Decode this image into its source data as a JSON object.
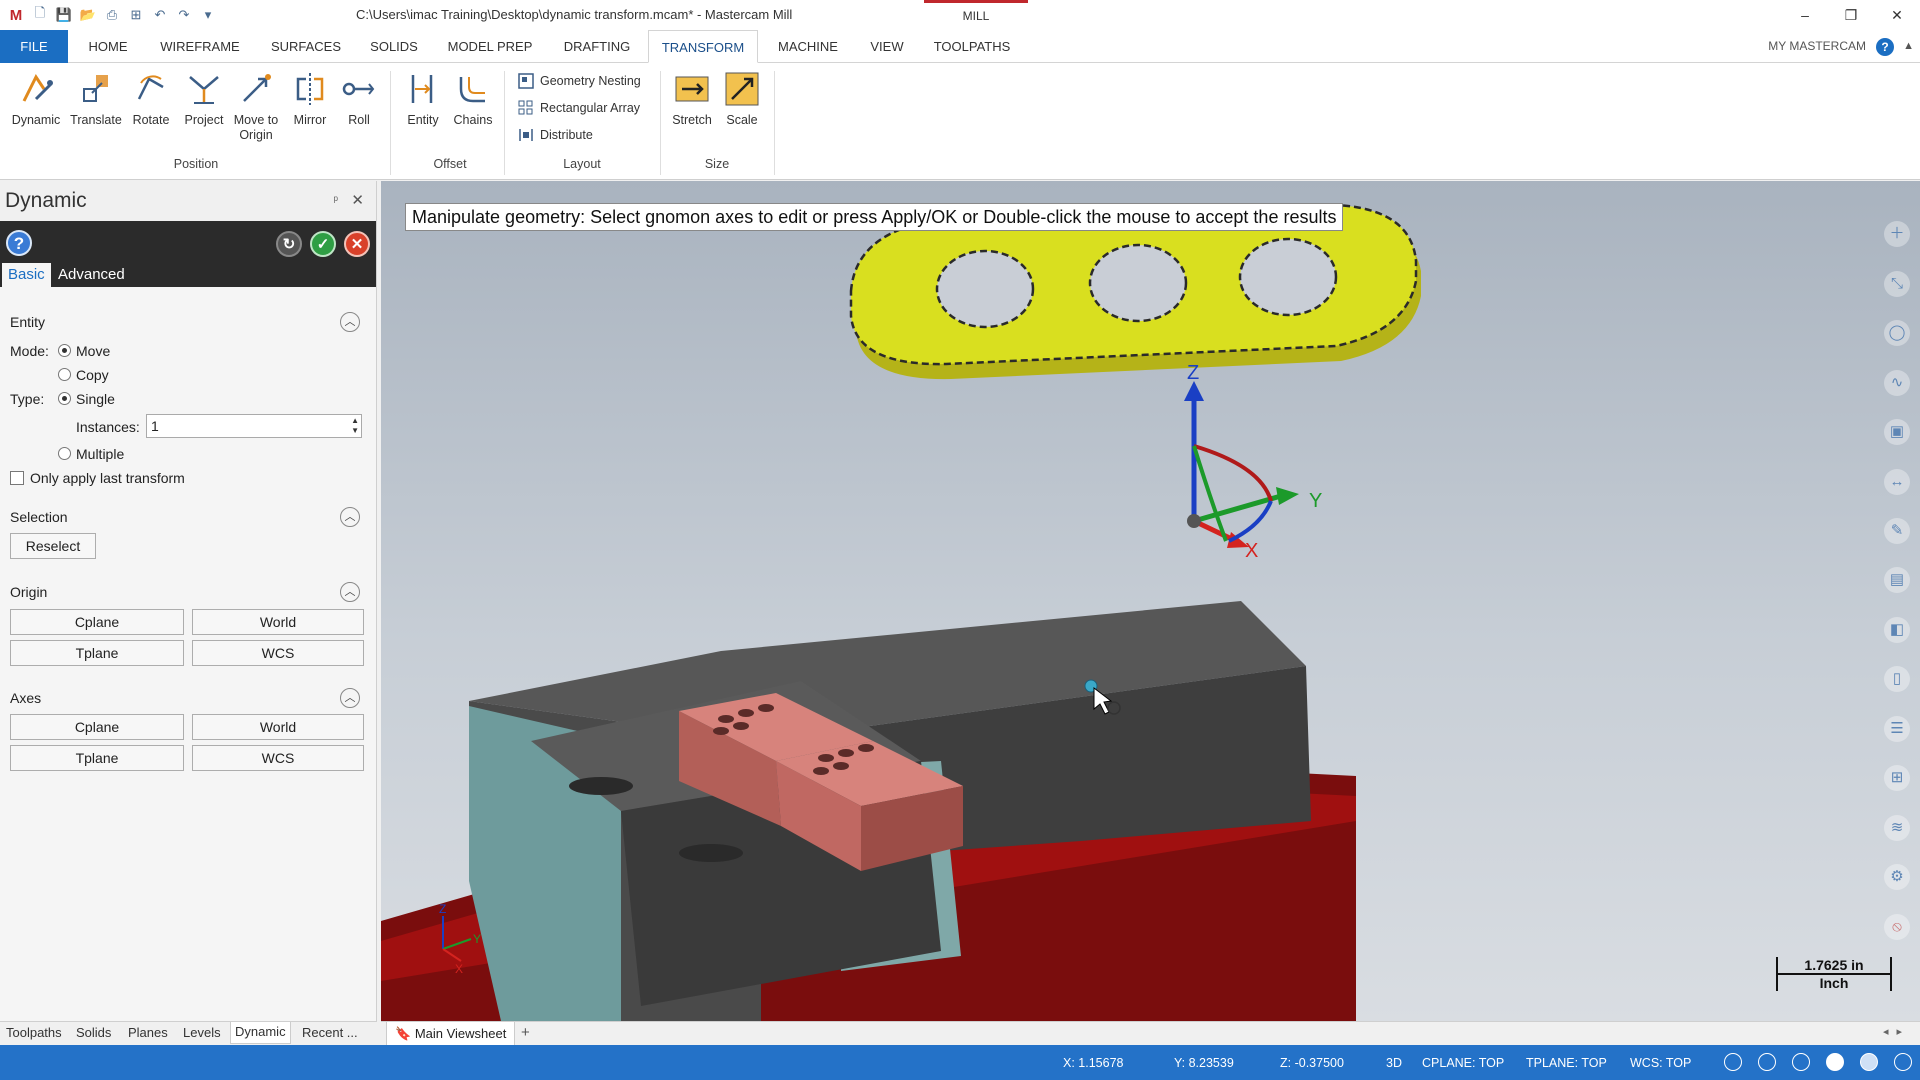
{
  "titlebar": {
    "title": "C:\\Users\\imac Training\\Desktop\\dynamic transform.mcam* - Mastercam Mill",
    "context_tab": "MILL",
    "quick_access_icons": [
      "new-file-icon",
      "save-icon",
      "open-icon",
      "print-icon",
      "save-as-icon",
      "undo-icon",
      "redo-icon"
    ],
    "window_controls": {
      "minimize": "–",
      "restore": "❐",
      "close": "✕"
    }
  },
  "ribbon_tabs": {
    "tabs": [
      "FILE",
      "HOME",
      "WIREFRAME",
      "SURFACES",
      "SOLIDS",
      "MODEL PREP",
      "DRAFTING",
      "TRANSFORM",
      "MACHINE",
      "VIEW",
      "TOOLPATHS"
    ],
    "active": "TRANSFORM",
    "my_mastercam": "MY MASTERCAM",
    "help": "?"
  },
  "ribbon": {
    "position": {
      "group_label": "Position",
      "buttons": [
        "Dynamic",
        "Translate",
        "Rotate",
        "Project",
        "Move to Origin",
        "Mirror",
        "Roll"
      ]
    },
    "offset": {
      "group_label": "Offset",
      "buttons": [
        "Entity",
        "Chains"
      ]
    },
    "layout": {
      "group_label": "Layout",
      "buttons": [
        "Geometry Nesting",
        "Rectangular Array",
        "Distribute"
      ]
    },
    "size": {
      "group_label": "Size",
      "buttons": [
        "Stretch",
        "Scale"
      ]
    }
  },
  "panel": {
    "title": "Dynamic",
    "pin": "ᵖ",
    "close": "✕",
    "tabs": [
      "Basic",
      "Advanced"
    ],
    "active_tab": "Basic",
    "entity": {
      "header": "Entity",
      "mode_label": "Mode:",
      "mode_options": [
        "Move",
        "Copy"
      ],
      "mode_selected": "Move",
      "type_label": "Type:",
      "type_options": [
        "Single",
        "Multiple"
      ],
      "type_selected": "Single",
      "instances_label": "Instances:",
      "instances_value": "1",
      "only_last_label": "Only apply last transform",
      "only_last_checked": false
    },
    "selection": {
      "header": "Selection",
      "reselect": "Reselect"
    },
    "origin": {
      "header": "Origin",
      "buttons": [
        "Cplane",
        "World",
        "Tplane",
        "WCS"
      ]
    },
    "axes": {
      "header": "Axes",
      "buttons": [
        "Cplane",
        "World",
        "Tplane",
        "WCS"
      ]
    }
  },
  "bottom_tabs": {
    "tabs": [
      "Toolpaths",
      "Solids",
      "Planes",
      "Levels",
      "Dynamic",
      "Recent ..."
    ],
    "active": "Dynamic"
  },
  "viewport": {
    "prompt": "Manipulate geometry: Select gnomon axes to edit or press Apply/OK or Double-click the mouse to accept the results",
    "gnomon_labels": {
      "z": "Z",
      "y": "Y",
      "x": "X"
    },
    "small_gnomon_labels": {
      "z": "Z",
      "y": "Y",
      "x": "X"
    },
    "scale_value": "1.7625 in",
    "scale_unit": "Inch",
    "right_toolbar_icons": [
      "plus-icon",
      "zoom-icon",
      "circle-icon",
      "curve-icon",
      "box-icon",
      "dimension-icon",
      "tag-icon",
      "layer-icon",
      "cube-icon",
      "page-icon",
      "list-icon",
      "grid-icon",
      "stack-icon",
      "gear-icon",
      "no-icon"
    ],
    "colors": {
      "part": "#d9df1f",
      "block": "#4a4a4a",
      "vise_jaw": "#6c9a9a",
      "fixture": "#a01010",
      "pads": "#d7706a",
      "z_axis": "#1a3fc4",
      "y_axis": "#1c9a2a",
      "x_axis": "#d4231f"
    }
  },
  "sheet_tabs": {
    "main": "Main Viewsheet",
    "add": "+"
  },
  "statusbar": {
    "x": "X:  1.15678",
    "y": "Y:  8.23539",
    "z": "Z:  -0.37500",
    "mode": "3D",
    "cplane": "CPLANE: TOP",
    "tplane": "TPLANE: TOP",
    "wcs": "WCS: TOP"
  }
}
